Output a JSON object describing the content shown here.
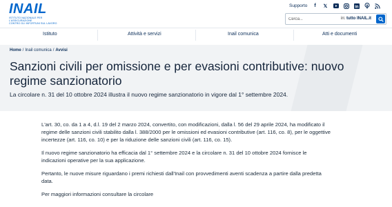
{
  "header": {
    "logo_word": "INAIL",
    "logo_sub_line1": "ISTITUTO NAZIONALE PER L'ASSICURAZIONE",
    "logo_sub_line2": "CONTRO GLI INFORTUNI SUL LAVORO",
    "supporto_label": "Supporto",
    "social_icons": [
      "facebook-icon",
      "x-icon",
      "youtube-icon",
      "instagram-icon",
      "linkedin-icon",
      "podcast-icon",
      "rss-icon"
    ],
    "search": {
      "placeholder": "Cerca...",
      "scope_prefix": "in:",
      "scope_value": "tutto INAIL.it"
    }
  },
  "nav": {
    "items": [
      "Istituto",
      "Attività e servizi",
      "Inail comunica",
      "Atti e documenti"
    ]
  },
  "breadcrumb": {
    "items": [
      "Home",
      "Inail comunica",
      "Avvisi"
    ],
    "separator": "/"
  },
  "page": {
    "title": "Sanzioni civili per omissione e per evasioni contributive: nuovo regime sanzionatorio",
    "subtitle": "La circolare n. 31 del 10 ottobre 2024 illustra il nuovo regime sanzionatorio in vigore dal 1° settembre 2024."
  },
  "content": {
    "paragraphs": [
      "L'art. 30, co. da 1 a 4, d.l. 19 del 2 marzo 2024, convertito, con modificazioni, dalla l. 56 del 29 aprile 2024, ha modificato il regime delle sanzioni civili stabilito dalla l. 388/2000 per le omissioni ed evasioni contributive (art. 116, co. 8), per le oggettive incertezze (art. 116, co. 10) e per la riduzione delle sanzioni civili (art. 116, co. 15).",
      "Il nuovo regime sanzionatorio ha efficacia dal 1° settembre 2024 e la circolare n. 31 del 10 ottobre 2024 fornisce le indicazioni operative per la sua applicazione.",
      "Pertanto, le nuove misure riguardano i premi richiesti dall'Inail con provvedimenti aventi scadenza a partire dalla predetta data.",
      "Per maggiori informazioni consultare la circolare"
    ]
  },
  "colors": {
    "brand_blue": "#0066cc",
    "dark_navy": "#0b2e59",
    "hero_bg": "#f1f3f5"
  }
}
